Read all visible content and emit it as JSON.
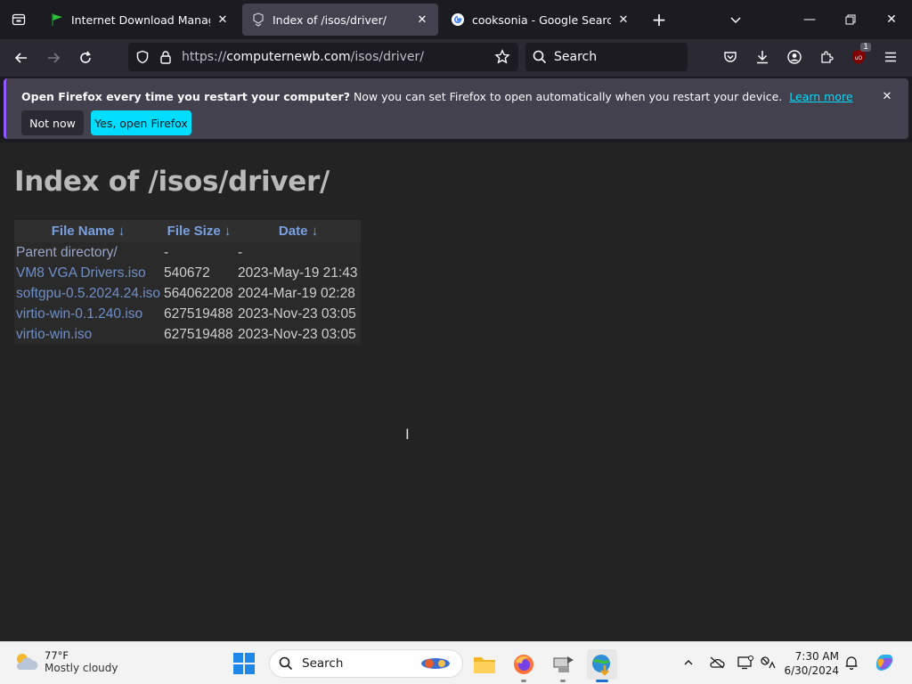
{
  "browser": {
    "tabs": [
      {
        "title": "Internet Download Manager is"
      },
      {
        "title": "Index of /isos/driver/"
      },
      {
        "title": "cooksonia - Google Search"
      }
    ],
    "url_prefix": "https://",
    "url_host": "computernewb.com",
    "url_path": "/isos/driver/",
    "search_placeholder": "Search",
    "extension_badge": "1"
  },
  "notification": {
    "bold": "Open Firefox every time you restart your computer?",
    "text": "Now you can set Firefox to open automatically when you restart your device.",
    "link": "Learn more",
    "not_now": "Not now",
    "yes": "Yes, open Firefox"
  },
  "page": {
    "heading": "Index of /isos/driver/",
    "columns": [
      "File Name  ↓",
      "File Size  ↓",
      "Date  ↓"
    ],
    "rows": [
      {
        "name": "Parent directory/",
        "size": "-",
        "date": "-"
      },
      {
        "name": "VM8 VGA Drivers.iso",
        "size": "540672",
        "date": "2023-May-19 21:43"
      },
      {
        "name": "softgpu-0.5.2024.24.iso",
        "size": "564062208",
        "date": "2024-Mar-19 02:28"
      },
      {
        "name": "virtio-win-0.1.240.iso",
        "size": "627519488",
        "date": "2023-Nov-23 03:05"
      },
      {
        "name": "virtio-win.iso",
        "size": "627519488",
        "date": "2023-Nov-23 03:05"
      }
    ]
  },
  "taskbar": {
    "temp": "77°F",
    "condition": "Mostly cloudy",
    "search": "Search",
    "time": "7:30 AM",
    "date": "6/30/2024"
  },
  "colors": {
    "accent": "#00ddff",
    "link": "#6f8fc8",
    "header_link": "#7aa0e0"
  }
}
